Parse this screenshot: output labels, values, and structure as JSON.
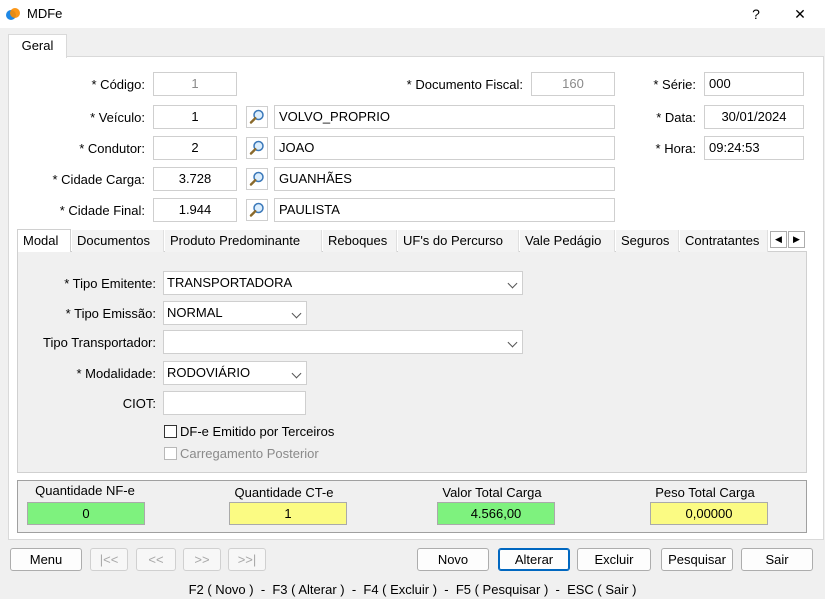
{
  "window": {
    "title": "MDFe",
    "help_label": "?",
    "close_label": "✕"
  },
  "main_tab": {
    "label": "Geral"
  },
  "form": {
    "codigo": {
      "label": "* Código:",
      "value": "1"
    },
    "documento_fiscal": {
      "label": "* Documento Fiscal:",
      "value": "160"
    },
    "serie": {
      "label": "* Série:",
      "value": "000"
    },
    "veiculo": {
      "label": "* Veículo:",
      "value": "1",
      "desc": "VOLVO_PROPRIO"
    },
    "data": {
      "label": "* Data:",
      "value": "30/01/2024"
    },
    "condutor": {
      "label": "* Condutor:",
      "value": "2",
      "desc": "JOAO"
    },
    "hora": {
      "label": "* Hora:",
      "value": "09:24:53"
    },
    "cidade_carga": {
      "label": "* Cidade Carga:",
      "value": "3.728",
      "desc": "GUANHÃES"
    },
    "cidade_final": {
      "label": "* Cidade Final:",
      "value": "1.944",
      "desc": "PAULISTA"
    }
  },
  "inner_tabs": [
    "Modal",
    "Documentos",
    "Produto Predominante",
    "Reboques",
    "UF's do Percurso",
    "Vale Pedágio",
    "Seguros",
    "Contratantes"
  ],
  "scroll": {
    "left": "◀",
    "right": "▶"
  },
  "modal": {
    "tipo_emitente": {
      "label": "* Tipo Emitente:",
      "value": "TRANSPORTADORA"
    },
    "tipo_emissao": {
      "label": "* Tipo Emissão:",
      "value": "NORMAL"
    },
    "tipo_transportador": {
      "label": "Tipo Transportador:",
      "value": ""
    },
    "modalidade": {
      "label": "* Modalidade:",
      "value": "RODOVIÁRIO"
    },
    "ciot": {
      "label": "CIOT:",
      "value": ""
    },
    "dfe_terceiros": {
      "label": "DF-e Emitido por Terceiros"
    },
    "carregamento_posterior": {
      "label": "Carregamento Posterior"
    }
  },
  "totals": [
    {
      "label": "Quantidade NF-e",
      "value": "0",
      "color": "#7ef27e"
    },
    {
      "label": "Quantidade CT-e",
      "value": "1",
      "color": "#fbfb83"
    },
    {
      "label": "Valor Total Carga",
      "value": "4.566,00",
      "color": "#7ef27e"
    },
    {
      "label": "Peso Total Carga",
      "value": "0,00000",
      "color": "#fbfb83"
    }
  ],
  "buttons": {
    "menu": "Menu",
    "first": "|<<",
    "prev": "<<",
    "next": ">>",
    "last": ">>|",
    "novo": "Novo",
    "alterar": "Alterar",
    "excluir": "Excluir",
    "pesquisar": "Pesquisar",
    "sair": "Sair"
  },
  "footer": "F2 ( Novo )  -  F3 ( Alterar )  -  F4 ( Excluir )  -  F5 ( Pesquisar )  -  ESC ( Sair )"
}
